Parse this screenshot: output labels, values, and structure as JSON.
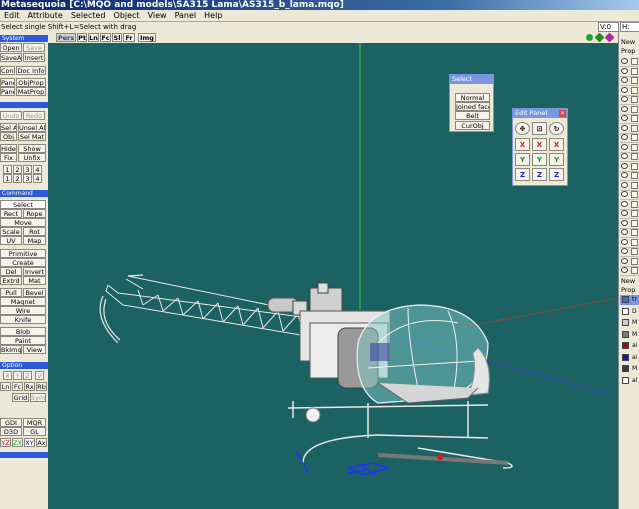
{
  "window": {
    "title": "Metasequoia [C:\\MQO and models\\SA315 Lama\\AS315_b_lama.mqo]"
  },
  "menu": [
    "Edit",
    "Attribute",
    "Selected",
    "Object",
    "View",
    "Panel",
    "Help"
  ],
  "status": {
    "hint": "Select single  Shift+L=Select with drag",
    "v_label": "V:0",
    "h_label": "H:"
  },
  "left_panel": {
    "sections": {
      "system": "System",
      "command": "Command",
      "option": "Option"
    },
    "buttons": {
      "open": "Open",
      "save": "Save",
      "save_as": "SaveAs",
      "insert": "Insert",
      "config": "Config",
      "doc_info": "Doc Info",
      "panel": "Panel",
      "obj_prop": "ObjProp",
      "panel2": "Panel",
      "mat_prop": "MatProp",
      "undo": "Undo",
      "redo": "Redo",
      "sel_all": "Sel All",
      "unsel_all": "Unsel All",
      "sel_obj": "Obj",
      "sel_mat": "Sel Mat",
      "hide": "Hide",
      "show": "Show",
      "fix": "Fix",
      "unfix": "Unfix",
      "n1": "1",
      "n2": "2",
      "n3": "3",
      "n4": "4",
      "m1": "1",
      "m2": "2",
      "m3": "3",
      "m4": "4",
      "select": "Select",
      "rect": "Rect",
      "rope": "Rope",
      "move": "Move",
      "scale": "Scale",
      "rot": "Rot",
      "uv": "UV",
      "map": "Map",
      "primitive": "Primitive",
      "create": "Create",
      "del": "Del",
      "invert": "Invert",
      "extrd": "Extrd",
      "mat": "Mat",
      "pull": "Pull",
      "bevel": "Bevel",
      "magnet": "Magnet",
      "wire": "Wire",
      "knife": "Knife",
      "blob": "Blob",
      "paint": "Paint",
      "bkimg": "BkImg",
      "view": "View",
      "opt_x": "X",
      "opt_y": "Y",
      "opt_z": "Z",
      "opt_v": "V",
      "ln": "Ln",
      "fc": "Fc",
      "rx": "Rx",
      "rb": "Rb",
      "grid": "Grid",
      "sym": "Sym",
      "gdi": "GDI",
      "mqr": "MQR",
      "d3d": "D3D",
      "gl": "GL",
      "yz": "YZ",
      "zx": "ZX",
      "xy": "XY",
      "ax": "Ax"
    }
  },
  "view_tabs": [
    "Pers",
    "Pt",
    "Ln",
    "Fc",
    "Sl",
    "Fr",
    "Img"
  ],
  "select_panel": {
    "title": "Select",
    "items": [
      "Normal",
      "Joined face",
      "Belt",
      "CurObj"
    ]
  },
  "edit_panel": {
    "title": "Edit Panel",
    "row_x": [
      "X",
      "X",
      "X"
    ],
    "row_y": [
      "Y",
      "Y",
      "Y"
    ],
    "row_z": [
      "Z",
      "Z",
      "Z"
    ]
  },
  "right_panel": {
    "objects_new": "New",
    "objects_prop": "Prop",
    "materials_new": "New",
    "materials_prop": "Prop",
    "materials": [
      {
        "label": "tr",
        "color": "#3d6ed8"
      },
      {
        "label": "D",
        "color": "#ffffff"
      },
      {
        "label": "M",
        "color": "#cfcfcf"
      },
      {
        "label": "M",
        "color": "#7a7a7a"
      },
      {
        "label": "ai",
        "color": "#9b1010"
      },
      {
        "label": "ai",
        "color": "#1717a8"
      },
      {
        "label": "M",
        "color": "#3b3b3b"
      },
      {
        "label": "al",
        "color": "#ffffff"
      }
    ]
  },
  "colors": {
    "viewport": "#1d6262",
    "panel_header": "#2c5ad8",
    "titlebar": "#0a246a"
  }
}
